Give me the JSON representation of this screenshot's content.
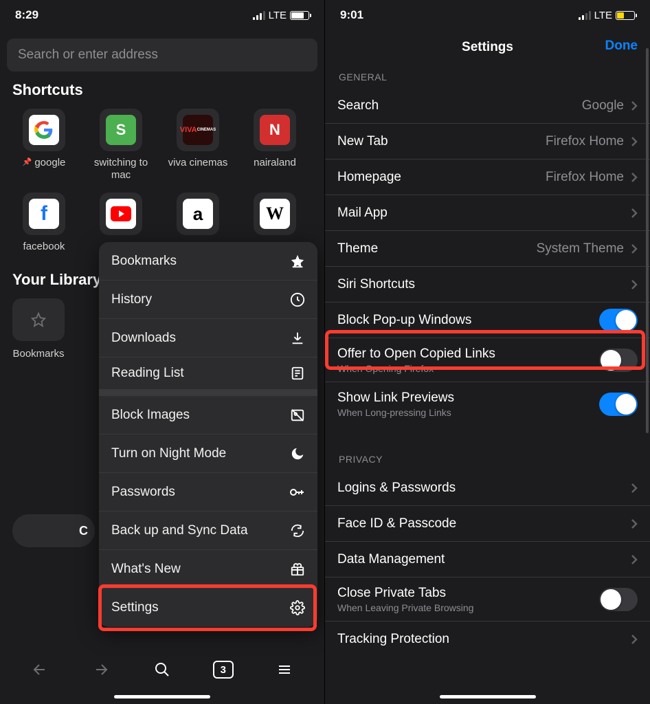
{
  "left": {
    "status": {
      "time": "8:29",
      "net": "LTE"
    },
    "search_placeholder": "Search or enter address",
    "shortcuts_title": "Shortcuts",
    "shortcuts": [
      {
        "label": "google",
        "pinned": true
      },
      {
        "label": "switching to mac"
      },
      {
        "label": "viva cinemas"
      },
      {
        "label": "nairaland"
      },
      {
        "label": "facebook"
      }
    ],
    "library_title": "Your Library",
    "library": {
      "bookmarks": "Bookmarks"
    },
    "menu": {
      "bookmarks": "Bookmarks",
      "history": "History",
      "downloads": "Downloads",
      "reading_list": "Reading List",
      "block_images": "Block Images",
      "night_mode": "Turn on Night Mode",
      "passwords": "Passwords",
      "backup_sync": "Back up and Sync Data",
      "whats_new": "What's New",
      "settings": "Settings"
    },
    "toolbar": {
      "tab_count": "3"
    }
  },
  "right": {
    "status": {
      "time": "9:01",
      "net": "LTE"
    },
    "nav": {
      "title": "Settings",
      "done": "Done"
    },
    "groups": {
      "general": "GENERAL",
      "privacy": "PRIVACY"
    },
    "rows": {
      "search": {
        "label": "Search",
        "value": "Google"
      },
      "new_tab": {
        "label": "New Tab",
        "value": "Firefox Home"
      },
      "homepage": {
        "label": "Homepage",
        "value": "Firefox Home"
      },
      "mail_app": {
        "label": "Mail App"
      },
      "theme": {
        "label": "Theme",
        "value": "System Theme"
      },
      "siri": {
        "label": "Siri Shortcuts"
      },
      "block_popups": {
        "label": "Block Pop-up Windows",
        "on": true
      },
      "copied_links": {
        "label": "Offer to Open Copied Links",
        "sub": "When Opening Firefox",
        "on": false
      },
      "link_previews": {
        "label": "Show Link Previews",
        "sub": "When Long-pressing Links",
        "on": true
      },
      "logins": {
        "label": "Logins & Passwords"
      },
      "faceid": {
        "label": "Face ID & Passcode"
      },
      "data_mgmt": {
        "label": "Data Management"
      },
      "close_private": {
        "label": "Close Private Tabs",
        "sub": "When Leaving Private Browsing",
        "on": false
      },
      "tracking": {
        "label": "Tracking Protection"
      }
    }
  }
}
